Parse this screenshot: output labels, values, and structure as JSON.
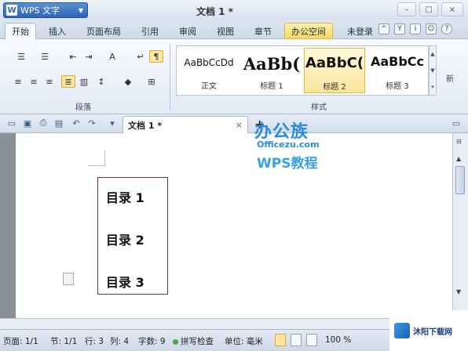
{
  "app": {
    "name": "WPS 文字",
    "logo_letter": "W",
    "doc_title": "文档 1 *"
  },
  "window_controls": [
    "–",
    "□",
    "×"
  ],
  "tabs": [
    {
      "label": "开始",
      "active": true
    },
    {
      "label": "插入"
    },
    {
      "label": "页面布局"
    },
    {
      "label": "引用"
    },
    {
      "label": "审阅"
    },
    {
      "label": "视图"
    },
    {
      "label": "章节"
    },
    {
      "label": "办公空间"
    }
  ],
  "account": {
    "login": "未登录"
  },
  "ribbon": {
    "paragraph_group": "段落",
    "styles_group": "样式",
    "new_style": "新",
    "styles": [
      {
        "sample": "AaBbCcDd",
        "name": "正文"
      },
      {
        "sample": "AaBb(",
        "name": "标题 1"
      },
      {
        "sample": "AaBbC(",
        "name": "标题 2"
      },
      {
        "sample": "AaBbCc",
        "name": "标题 3"
      }
    ]
  },
  "doc_tab": {
    "title": "文档 1 *",
    "close": "×",
    "new_tab": "+"
  },
  "watermark": {
    "line1": "办公族",
    "line2": "Officezu.com",
    "line3": "WPS教程"
  },
  "document": {
    "toc": [
      "目录 1",
      "目录 2",
      "目录 3"
    ]
  },
  "status": {
    "page": "页面: 1/1",
    "section": "节: 1/1",
    "row": "行: 3",
    "col": "列: 4",
    "words": "字数: 9",
    "spell": "拼写检查",
    "unit": "单位: 毫米",
    "zoom": "100 %"
  },
  "brand": {
    "text": "沐阳下载网"
  }
}
